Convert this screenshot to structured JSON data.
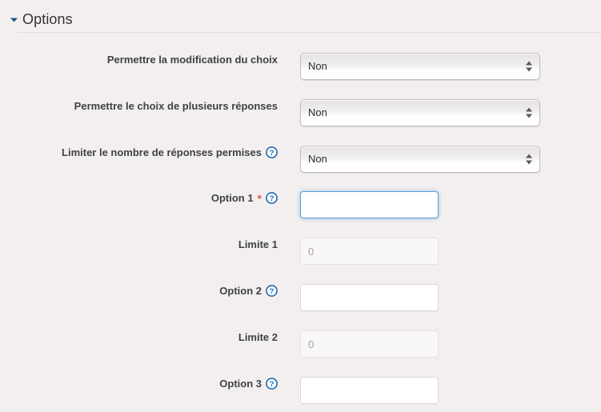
{
  "section": {
    "title": "Options",
    "collapse_icon": "triangle-down-icon",
    "collapsed": false
  },
  "theme": {
    "page_background": "#f4efef",
    "label_color": "#3e4246",
    "required_color": "#e8584f",
    "help_icon_color": "#1c6cb5",
    "focus_border_color": "#5b9fd9",
    "divider_color": "#e3dcdc"
  },
  "rows": [
    {
      "id": "allow-choice-update",
      "label": "Permettre la modification du choix",
      "control": "select",
      "value": "Non",
      "required": false,
      "help": false,
      "disabled": false,
      "focused": false
    },
    {
      "id": "allow-multiple-answers",
      "label": "Permettre le choix de plusieurs réponses",
      "control": "select",
      "value": "Non",
      "required": false,
      "help": false,
      "disabled": false,
      "focused": false
    },
    {
      "id": "limit-number-of-answers",
      "label": "Limiter le nombre de réponses permises",
      "control": "select",
      "value": "Non",
      "required": false,
      "help": true,
      "disabled": false,
      "focused": false
    },
    {
      "id": "option-1",
      "label": "Option 1",
      "control": "text",
      "value": "",
      "placeholder": "",
      "required": true,
      "help": true,
      "disabled": false,
      "focused": true
    },
    {
      "id": "limite-1",
      "label": "Limite 1",
      "control": "text",
      "value": "",
      "placeholder": "0",
      "required": false,
      "help": false,
      "disabled": true,
      "focused": false
    },
    {
      "id": "option-2",
      "label": "Option 2",
      "control": "text",
      "value": "",
      "placeholder": "",
      "required": false,
      "help": true,
      "disabled": false,
      "focused": false
    },
    {
      "id": "limite-2",
      "label": "Limite 2",
      "control": "text",
      "value": "",
      "placeholder": "0",
      "required": false,
      "help": false,
      "disabled": true,
      "focused": false
    },
    {
      "id": "option-3",
      "label": "Option 3",
      "control": "text",
      "value": "",
      "placeholder": "",
      "required": false,
      "help": true,
      "disabled": false,
      "focused": false
    }
  ],
  "icons": {
    "help": "help-circle-icon",
    "required": "*",
    "select_stepper": "stepper-arrows-icon"
  }
}
